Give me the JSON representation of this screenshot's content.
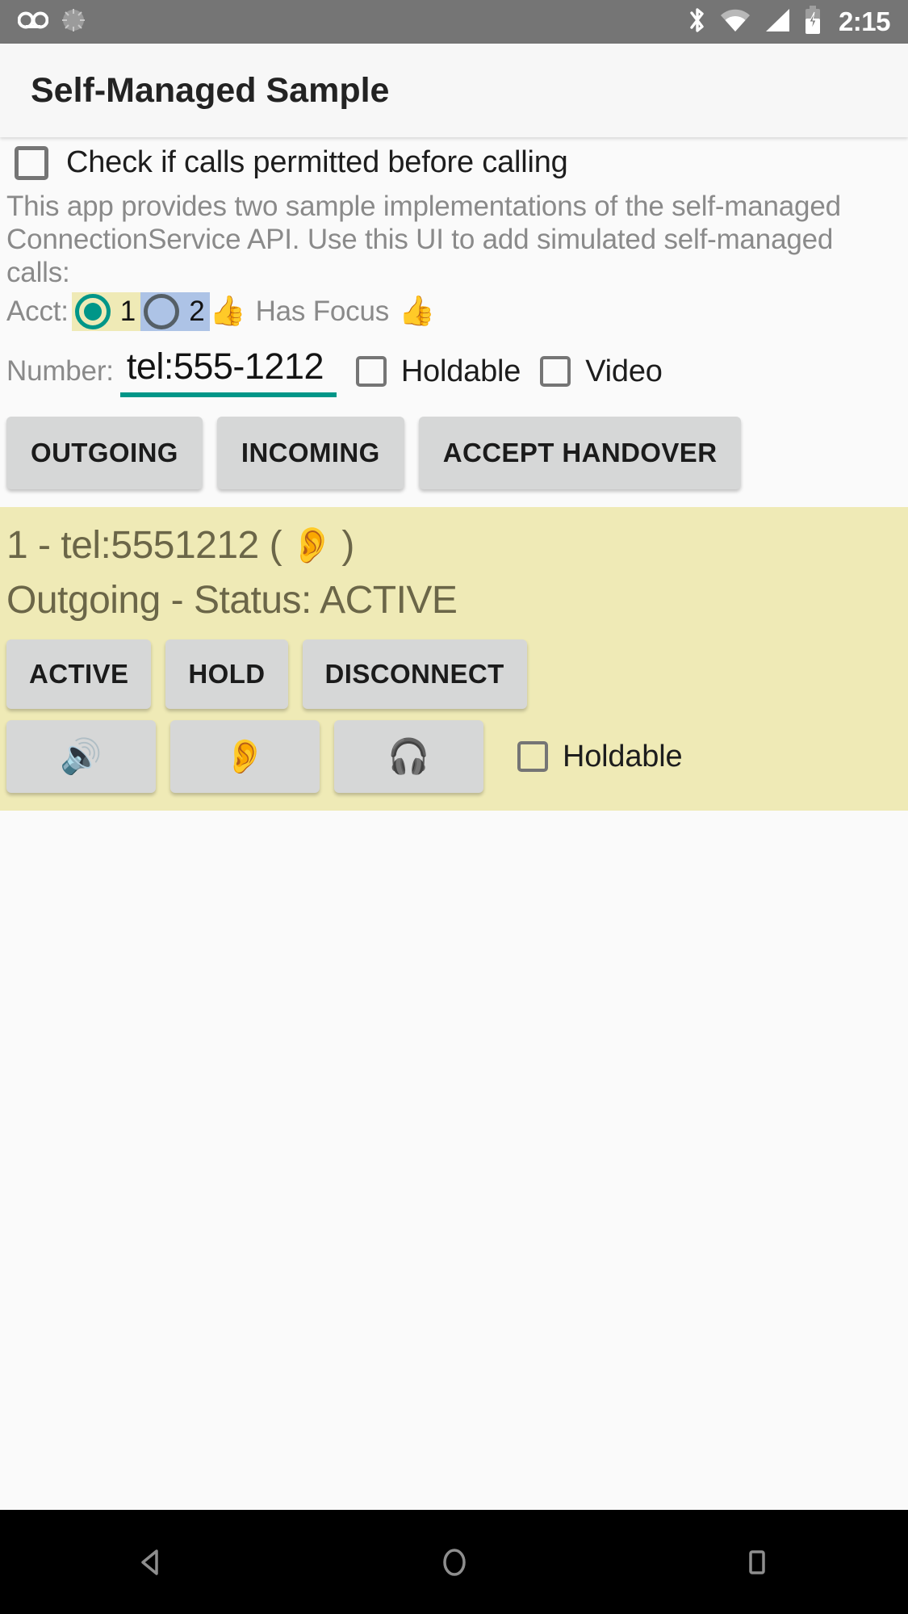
{
  "status_bar": {
    "time": "2:15",
    "icons_left": [
      "voicemail-icon",
      "sync-icon"
    ],
    "icons_right": [
      "bluetooth-icon",
      "wifi-icon",
      "cellular-signal-icon",
      "battery-charging-icon"
    ],
    "background_color": "#757575"
  },
  "app_bar": {
    "title": "Self-Managed Sample",
    "background_color": "#f7f7f7"
  },
  "permission_check": {
    "label": "Check if calls permitted before calling",
    "checked": false
  },
  "description": "This app provides two sample implementations of the self-managed ConnectionService API.  Use this UI to add simulated self-managed calls:",
  "account": {
    "label": "Acct:",
    "options": [
      {
        "value": "1",
        "selected": true,
        "highlight_color": "#efeab6"
      },
      {
        "value": "2",
        "selected": false,
        "highlight_color": "#adc3e6"
      }
    ],
    "focus_icon_left": "thumbs-up-icon",
    "focus_text": "Has Focus",
    "focus_icon_right": "thumbs-up-icon",
    "focus_emoji": "👍"
  },
  "number": {
    "label": "Number:",
    "value": "tel:555-1212",
    "placeholder": "tel:555-1212",
    "underline_color": "#009688",
    "holdable": {
      "label": "Holdable",
      "checked": false
    },
    "video": {
      "label": "Video",
      "checked": false
    }
  },
  "actions": [
    {
      "id": "outgoing",
      "label": "OUTGOING"
    },
    {
      "id": "incoming",
      "label": "INCOMING"
    },
    {
      "id": "accept-handover",
      "label": "ACCEPT HANDOVER"
    }
  ],
  "call_card": {
    "background_color": "#efeab6",
    "title_prefix": "1 - tel:5551212 (",
    "title_suffix": ")",
    "route_icon": "ear-icon",
    "route_emoji": "👂",
    "status_line": "Outgoing - Status: ACTIVE",
    "controls": [
      {
        "id": "active",
        "label": "ACTIVE"
      },
      {
        "id": "hold",
        "label": "HOLD"
      },
      {
        "id": "disconnect",
        "label": "DISCONNECT"
      }
    ],
    "audio_routes": [
      {
        "id": "speaker",
        "icon": "speaker-icon",
        "emoji": "🔊"
      },
      {
        "id": "earpiece",
        "icon": "ear-icon",
        "emoji": "👂"
      },
      {
        "id": "headset",
        "icon": "headphones-icon",
        "emoji": "🎧"
      }
    ],
    "holdable": {
      "label": "Holdable",
      "checked": false
    }
  },
  "nav_bar": {
    "background_color": "#000000",
    "buttons": [
      {
        "id": "back",
        "icon": "back-triangle-icon"
      },
      {
        "id": "home",
        "icon": "home-circle-icon"
      },
      {
        "id": "recents",
        "icon": "recents-square-icon"
      }
    ]
  }
}
